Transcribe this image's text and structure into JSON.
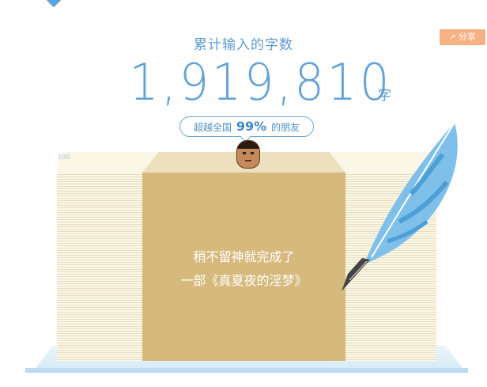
{
  "header": {
    "title": "累计输入的字数",
    "share_label": "分享"
  },
  "counter": {
    "value": "1,919,810",
    "unit": "字"
  },
  "rank": {
    "prefix": "超越全国",
    "percent": "99%",
    "suffix": "的朋友"
  },
  "stack": {
    "label": "100"
  },
  "box": {
    "line1": "稍不留神就完成了",
    "line2": "一部《真夏夜的淫梦》"
  },
  "icons": {
    "share": "share-icon",
    "quill": "quill-pen-icon",
    "avatar": "avatar"
  },
  "colors": {
    "accent": "#5b9bd2",
    "share_bg": "#f6b184",
    "box": "#d6b97d",
    "paper": "#fbf7e6"
  }
}
